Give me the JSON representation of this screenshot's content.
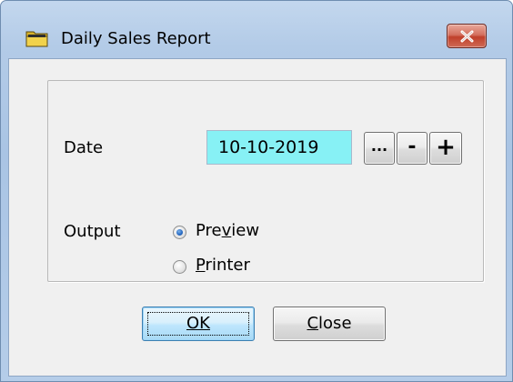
{
  "window": {
    "title": "Daily Sales Report",
    "icon": "folder-icon",
    "close_icon": "close-icon"
  },
  "form": {
    "date_label": "Date",
    "date_value": "10-10-2019",
    "browse_label": "...",
    "minus_label": "-",
    "plus_label": "+",
    "output_label": "Output",
    "options": [
      {
        "label": "Preview",
        "selected": true
      },
      {
        "label": "Printer",
        "selected": false
      }
    ]
  },
  "buttons": {
    "ok_label": "OK",
    "close_label": "Close"
  },
  "colors": {
    "date_field_bg": "#87f1f5",
    "close_button": "#c0402b",
    "frame": "#b3cbe7"
  }
}
